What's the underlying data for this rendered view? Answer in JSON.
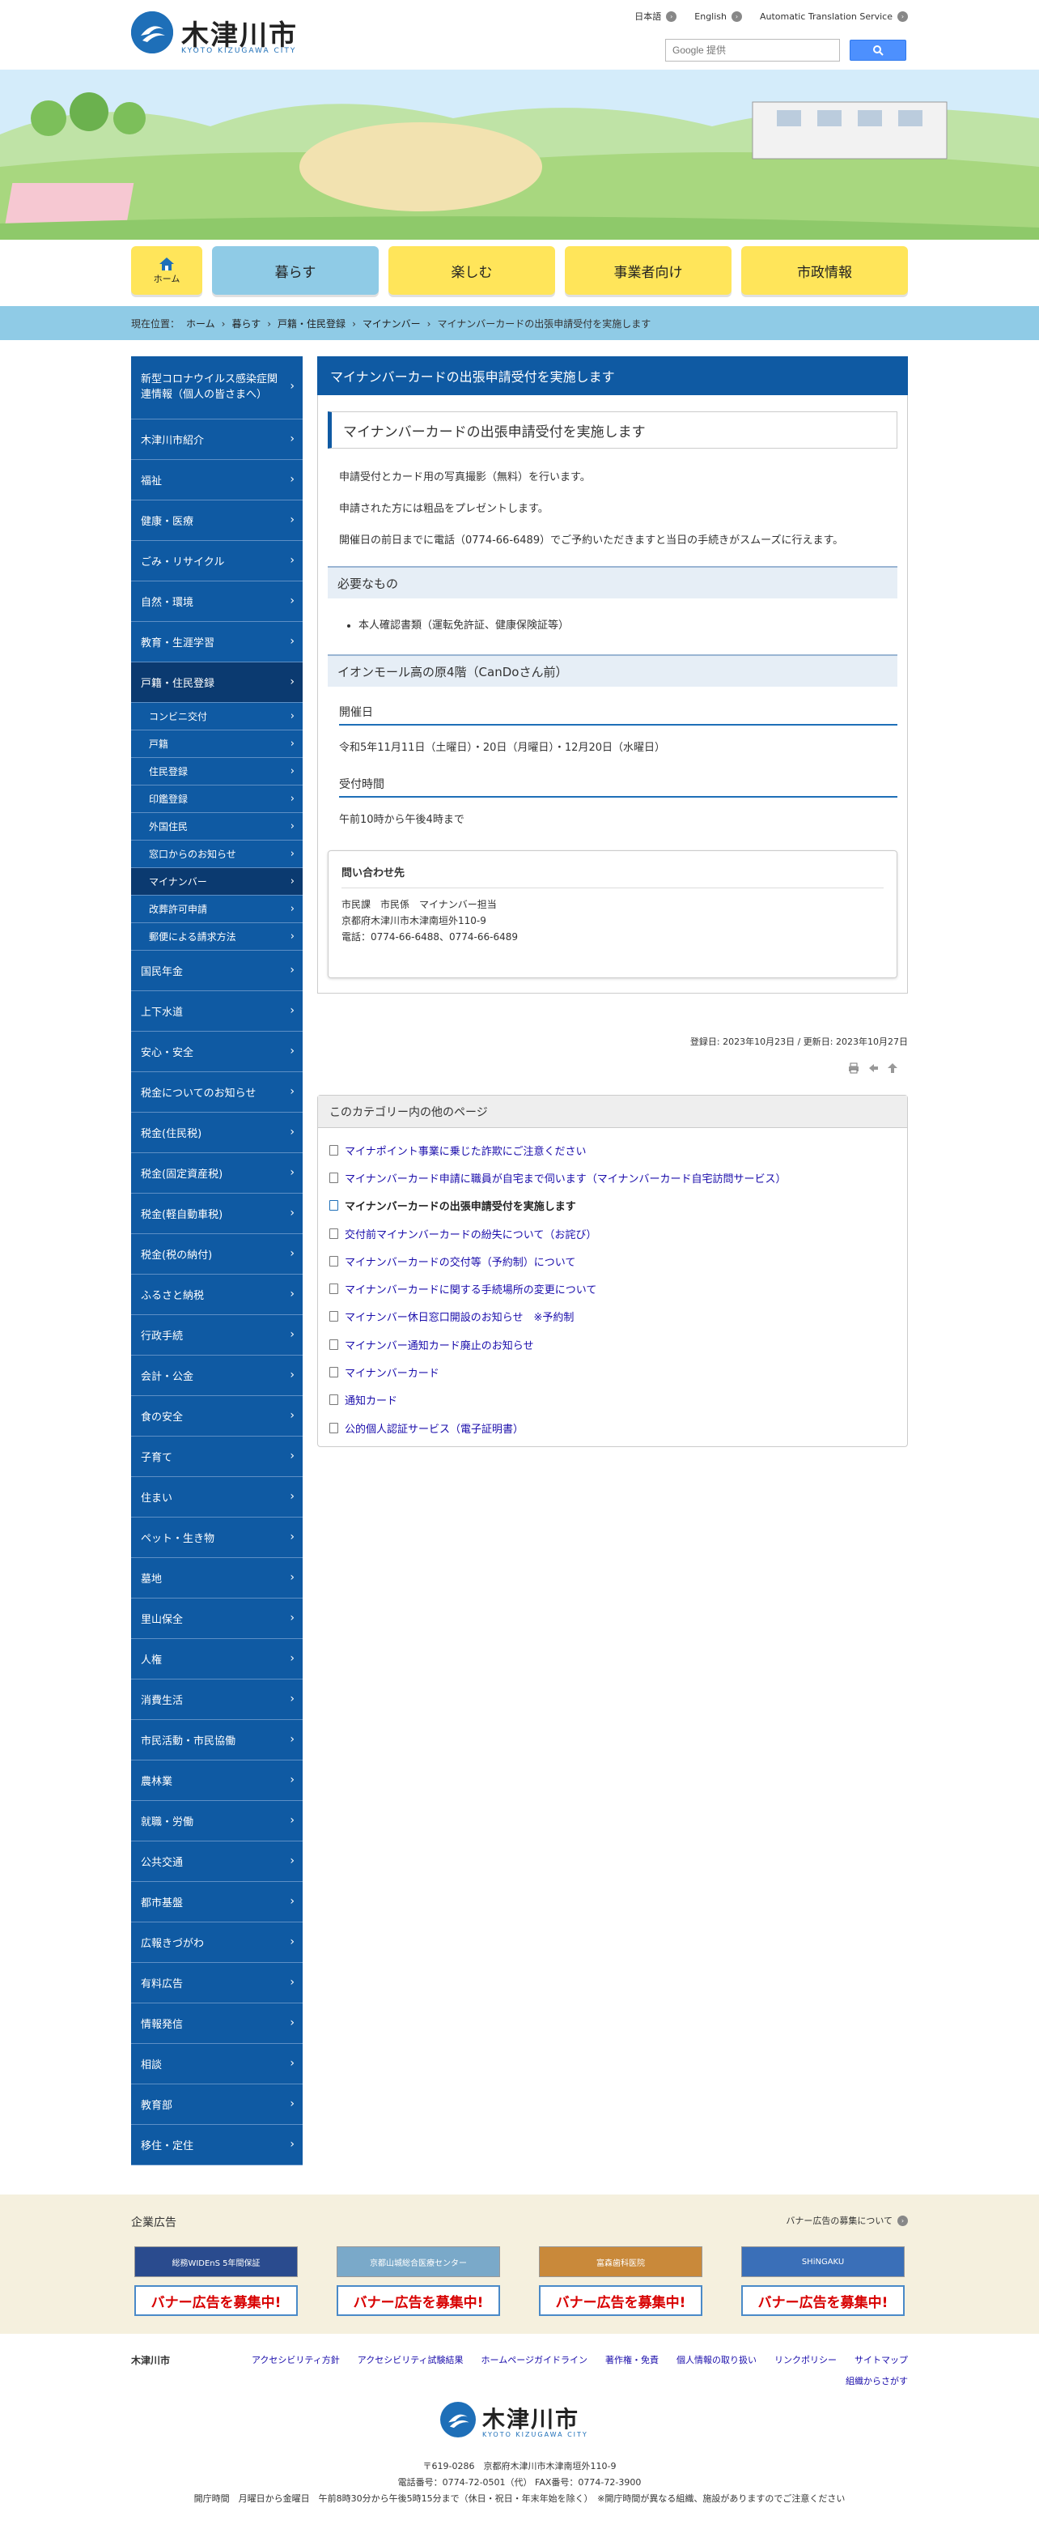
{
  "header": {
    "logo_name": "木津川市",
    "logo_sub": "KYOTO KIZUGAWA CITY",
    "lang_links": [
      "日本語",
      "English",
      "Automatic Translation Service"
    ],
    "search_placeholder": "Google 提供"
  },
  "gnav": [
    {
      "label": "ホーム",
      "color": "#ffe55a"
    },
    {
      "label": "暮らす",
      "color": "#8fcbe6"
    },
    {
      "label": "楽しむ",
      "color": "#ffe55a"
    },
    {
      "label": "事業者向け",
      "color": "#ffe55a"
    },
    {
      "label": "市政情報",
      "color": "#ffe55a"
    }
  ],
  "breadcrumb": {
    "prefix": "現在位置：",
    "items": [
      "ホーム",
      "暮らす",
      "戸籍・住民登録",
      "マイナンバー"
    ],
    "current": "マイナンバーカードの出張申請受付を実施します"
  },
  "sidebar": {
    "items": [
      {
        "label": "新型コロナウイルス感染症関連情報（個人の皆さまへ）"
      },
      {
        "label": "木津川市紹介"
      },
      {
        "label": "福祉"
      },
      {
        "label": "健康・医療"
      },
      {
        "label": "ごみ・リサイクル"
      },
      {
        "label": "自然・環境"
      },
      {
        "label": "教育・生涯学習"
      },
      {
        "label": "戸籍・住民登録"
      },
      {
        "label": "国民年金"
      },
      {
        "label": "上下水道"
      },
      {
        "label": "安心・安全"
      },
      {
        "label": "税金についてのお知らせ"
      },
      {
        "label": "税金(住民税)"
      },
      {
        "label": "税金(固定資産税)"
      },
      {
        "label": "税金(軽自動車税)"
      },
      {
        "label": "税金(税の納付)"
      },
      {
        "label": "ふるさと納税"
      },
      {
        "label": "行政手続"
      },
      {
        "label": "会計・公金"
      },
      {
        "label": "食の安全"
      },
      {
        "label": "子育て"
      },
      {
        "label": "住まい"
      },
      {
        "label": "ペット・生き物"
      },
      {
        "label": "墓地"
      },
      {
        "label": "里山保全"
      },
      {
        "label": "人権"
      },
      {
        "label": "消費生活"
      },
      {
        "label": "市民活動・市民協働"
      },
      {
        "label": "農林業"
      },
      {
        "label": "就職・労働"
      },
      {
        "label": "公共交通"
      },
      {
        "label": "都市基盤"
      },
      {
        "label": "広報きづがわ"
      },
      {
        "label": "有料広告"
      },
      {
        "label": "情報発信"
      },
      {
        "label": "相談"
      },
      {
        "label": "教育部"
      },
      {
        "label": "移住・定住"
      }
    ],
    "subitems": [
      "コンビニ交付",
      "戸籍",
      "住民登録",
      "印鑑登録",
      "外国住民",
      "窓口からのお知らせ",
      "マイナンバー",
      "改葬許可申請",
      "郵便による請求方法"
    ]
  },
  "main": {
    "page_title": "マイナンバーカードの出張申請受付を実施します",
    "heading": "マイナンバーカードの出張申請受付を実施します",
    "intro": [
      "申請受付とカード用の写真撮影（無料）を行います。",
      "申請された方には粗品をプレゼントします。",
      "開催日の前日までに電話（0774-66-6489）でご予約いただきますと当日の手続きがスムーズに行えます。"
    ],
    "needs_title": "必要なもの",
    "needs_item": "本人確認書類（運転免許証、健康保険証等）",
    "venue_title": "イオンモール高の原4階（CanDoさん前）",
    "date_title": "開催日",
    "date_text": "令和5年11月11日（土曜日）・20日（月曜日）・12月20日（水曜日）",
    "time_title": "受付時間",
    "time_text": "午前10時から午後4時まで",
    "inquiry": {
      "title": "問い合わせ先",
      "dept": "市民課　市民係　マイナンバー担当",
      "address": "京都府木津川市木津南垣外110-9",
      "tel": "電話：0774-66-6488、0774-66-6489"
    },
    "dates": "登録日: 2023年10月23日 / 更新日: 2023年10月27日"
  },
  "category": {
    "title": "このカテゴリー内の他のページ",
    "links": [
      "マイナポイント事業に乗じた詐欺にご注意ください",
      "マイナンバーカード申請に職員が自宅まで伺います（マイナンバーカード自宅訪問サービス）",
      "マイナンバーカードの出張申請受付を実施します",
      "交付前マイナンバーカードの紛失について（お詫び）",
      "マイナンバーカードの交付等（予約制）について",
      "マイナンバーカードに関する手続場所の変更について",
      "マイナンバー休日窓口開設のお知らせ　※予約制",
      "マイナンバー通知カード廃止のお知らせ",
      "マイナンバーカード",
      "通知カード",
      "公的個人認証サービス（電子証明書）"
    ],
    "current_index": 2
  },
  "ads": {
    "title": "企業広告",
    "about": "バナー広告の募集について",
    "banners": [
      {
        "top": "総務WIDEnS 5年間保証",
        "bottom": "バナー広告を募集中!",
        "color": "#2a4b8e"
      },
      {
        "top": "京都山城総合医療センター",
        "bottom": "バナー広告を募集中!",
        "color": "#7aa9c9"
      },
      {
        "top": "富森歯科医院",
        "bottom": "バナー広告を募集中!",
        "color": "#c9893a"
      },
      {
        "top": "SHiNGAKU",
        "bottom": "バナー広告を募集中!",
        "color": "#3a6fb8"
      }
    ]
  },
  "footer": {
    "name": "木津川市",
    "links": [
      "アクセシビリティ方針",
      "アクセシビリティ試験結果",
      "ホームページガイドライン",
      "著作権・免責",
      "個人情報の取り扱い",
      "リンクポリシー",
      "サイトマップ",
      "組織からさがす"
    ],
    "address": "〒619-0286　京都府木津川市木津南垣外110-9",
    "phone": "電話番号：0774-72-0501（代）  FAX番号：0774-72-3900",
    "hours": "開庁時間　月曜日から金曜日　午前8時30分から午後5時15分まで（休日・祝日・年末年始を除く）　※開庁時間が異なる組織、施設がありますのでご注意ください"
  }
}
